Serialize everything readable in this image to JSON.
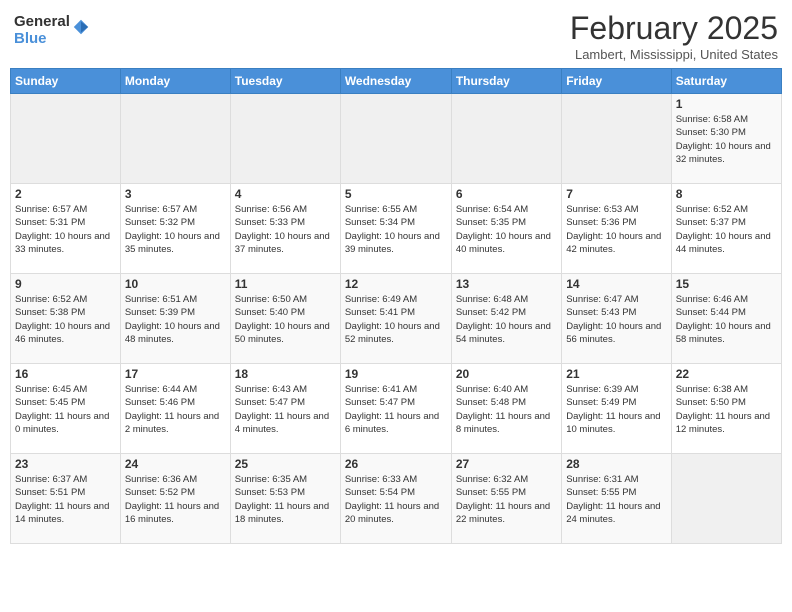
{
  "logo": {
    "general": "General",
    "blue": "Blue"
  },
  "title": {
    "month_year": "February 2025",
    "location": "Lambert, Mississippi, United States"
  },
  "weekdays": [
    "Sunday",
    "Monday",
    "Tuesday",
    "Wednesday",
    "Thursday",
    "Friday",
    "Saturday"
  ],
  "weeks": [
    [
      {
        "day": "",
        "info": ""
      },
      {
        "day": "",
        "info": ""
      },
      {
        "day": "",
        "info": ""
      },
      {
        "day": "",
        "info": ""
      },
      {
        "day": "",
        "info": ""
      },
      {
        "day": "",
        "info": ""
      },
      {
        "day": "1",
        "info": "Sunrise: 6:58 AM\nSunset: 5:30 PM\nDaylight: 10 hours and 32 minutes."
      }
    ],
    [
      {
        "day": "2",
        "info": "Sunrise: 6:57 AM\nSunset: 5:31 PM\nDaylight: 10 hours and 33 minutes."
      },
      {
        "day": "3",
        "info": "Sunrise: 6:57 AM\nSunset: 5:32 PM\nDaylight: 10 hours and 35 minutes."
      },
      {
        "day": "4",
        "info": "Sunrise: 6:56 AM\nSunset: 5:33 PM\nDaylight: 10 hours and 37 minutes."
      },
      {
        "day": "5",
        "info": "Sunrise: 6:55 AM\nSunset: 5:34 PM\nDaylight: 10 hours and 39 minutes."
      },
      {
        "day": "6",
        "info": "Sunrise: 6:54 AM\nSunset: 5:35 PM\nDaylight: 10 hours and 40 minutes."
      },
      {
        "day": "7",
        "info": "Sunrise: 6:53 AM\nSunset: 5:36 PM\nDaylight: 10 hours and 42 minutes."
      },
      {
        "day": "8",
        "info": "Sunrise: 6:52 AM\nSunset: 5:37 PM\nDaylight: 10 hours and 44 minutes."
      }
    ],
    [
      {
        "day": "9",
        "info": "Sunrise: 6:52 AM\nSunset: 5:38 PM\nDaylight: 10 hours and 46 minutes."
      },
      {
        "day": "10",
        "info": "Sunrise: 6:51 AM\nSunset: 5:39 PM\nDaylight: 10 hours and 48 minutes."
      },
      {
        "day": "11",
        "info": "Sunrise: 6:50 AM\nSunset: 5:40 PM\nDaylight: 10 hours and 50 minutes."
      },
      {
        "day": "12",
        "info": "Sunrise: 6:49 AM\nSunset: 5:41 PM\nDaylight: 10 hours and 52 minutes."
      },
      {
        "day": "13",
        "info": "Sunrise: 6:48 AM\nSunset: 5:42 PM\nDaylight: 10 hours and 54 minutes."
      },
      {
        "day": "14",
        "info": "Sunrise: 6:47 AM\nSunset: 5:43 PM\nDaylight: 10 hours and 56 minutes."
      },
      {
        "day": "15",
        "info": "Sunrise: 6:46 AM\nSunset: 5:44 PM\nDaylight: 10 hours and 58 minutes."
      }
    ],
    [
      {
        "day": "16",
        "info": "Sunrise: 6:45 AM\nSunset: 5:45 PM\nDaylight: 11 hours and 0 minutes."
      },
      {
        "day": "17",
        "info": "Sunrise: 6:44 AM\nSunset: 5:46 PM\nDaylight: 11 hours and 2 minutes."
      },
      {
        "day": "18",
        "info": "Sunrise: 6:43 AM\nSunset: 5:47 PM\nDaylight: 11 hours and 4 minutes."
      },
      {
        "day": "19",
        "info": "Sunrise: 6:41 AM\nSunset: 5:47 PM\nDaylight: 11 hours and 6 minutes."
      },
      {
        "day": "20",
        "info": "Sunrise: 6:40 AM\nSunset: 5:48 PM\nDaylight: 11 hours and 8 minutes."
      },
      {
        "day": "21",
        "info": "Sunrise: 6:39 AM\nSunset: 5:49 PM\nDaylight: 11 hours and 10 minutes."
      },
      {
        "day": "22",
        "info": "Sunrise: 6:38 AM\nSunset: 5:50 PM\nDaylight: 11 hours and 12 minutes."
      }
    ],
    [
      {
        "day": "23",
        "info": "Sunrise: 6:37 AM\nSunset: 5:51 PM\nDaylight: 11 hours and 14 minutes."
      },
      {
        "day": "24",
        "info": "Sunrise: 6:36 AM\nSunset: 5:52 PM\nDaylight: 11 hours and 16 minutes."
      },
      {
        "day": "25",
        "info": "Sunrise: 6:35 AM\nSunset: 5:53 PM\nDaylight: 11 hours and 18 minutes."
      },
      {
        "day": "26",
        "info": "Sunrise: 6:33 AM\nSunset: 5:54 PM\nDaylight: 11 hours and 20 minutes."
      },
      {
        "day": "27",
        "info": "Sunrise: 6:32 AM\nSunset: 5:55 PM\nDaylight: 11 hours and 22 minutes."
      },
      {
        "day": "28",
        "info": "Sunrise: 6:31 AM\nSunset: 5:55 PM\nDaylight: 11 hours and 24 minutes."
      },
      {
        "day": "",
        "info": ""
      }
    ]
  ]
}
